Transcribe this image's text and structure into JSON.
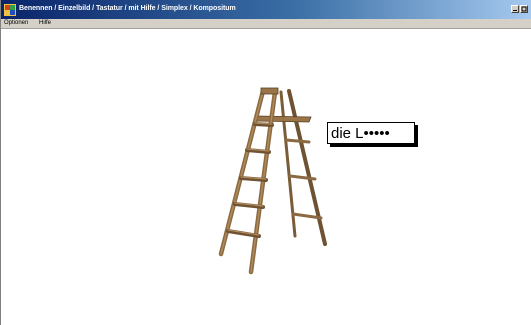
{
  "window": {
    "title": "Benennen / Einzelbild / Tastatur / mit Hilfe / Simplex / Kompositum",
    "controls": [
      "minimize-icon",
      "maximize-icon"
    ]
  },
  "menu": {
    "items": [
      {
        "label": "Optionen"
      },
      {
        "label": "Hilfe"
      }
    ]
  },
  "exercise": {
    "image_icon": "ladder-image",
    "answer_text": "die L•••••"
  },
  "colors": {
    "titlebar_start": "#0a246a",
    "titlebar_end": "#a6caf0",
    "wood": "#8b6a42"
  }
}
